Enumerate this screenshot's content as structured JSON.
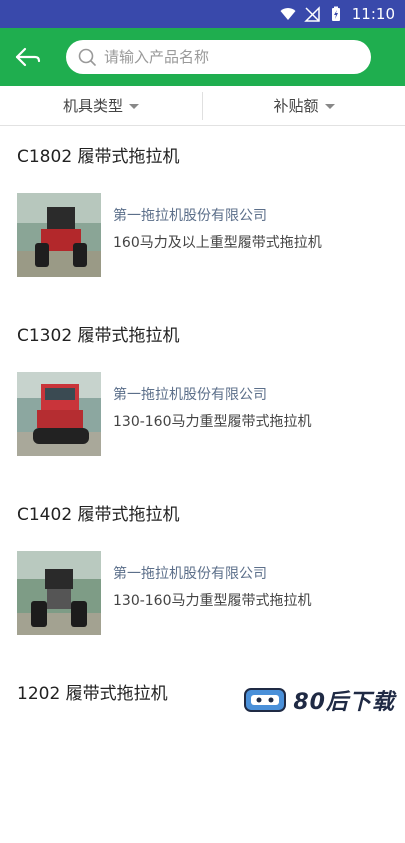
{
  "status_bar": {
    "time": "11:10"
  },
  "search": {
    "placeholder": "请输入产品名称"
  },
  "filters": [
    {
      "label": "机具类型"
    },
    {
      "label": "补贴额"
    }
  ],
  "products": [
    {
      "title": "C1802 履带式拖拉机",
      "company": "第一拖拉机股份有限公司",
      "desc": "160马力及以上重型履带式拖拉机"
    },
    {
      "title": "C1302 履带式拖拉机",
      "company": "第一拖拉机股份有限公司",
      "desc": "130-160马力重型履带式拖拉机"
    },
    {
      "title": "C1402 履带式拖拉机",
      "company": "第一拖拉机股份有限公司",
      "desc": "130-160马力重型履带式拖拉机"
    },
    {
      "title": "1202 履带式拖拉机"
    }
  ],
  "watermark": {
    "text": "80后下载"
  }
}
